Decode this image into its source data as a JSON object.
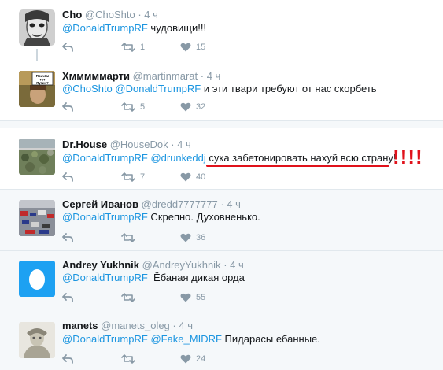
{
  "tweets": [
    {
      "name": "Cho",
      "handle": "@ChoShto",
      "time": "· 4 ч",
      "mentions": [
        "@DonaldTrumpRF"
      ],
      "text": " чудовищи!!!",
      "retweets": "1",
      "likes": "15"
    },
    {
      "name": "Хмммммарти",
      "handle": "@martinmarat",
      "time": "· 4 ч",
      "mentions": [
        "@ChoShto",
        "@DonaldTrumpRF"
      ],
      "text": " и эти твари требуют от нас скорбеть",
      "avatar_caption": "Причём тут Путин?",
      "retweets": "5",
      "likes": "32"
    },
    {
      "name": "Dr.House",
      "handle": "@HouseDok",
      "time": "· 4 ч",
      "mentions": [
        "@DonaldTrumpRF",
        "@drunkeddj"
      ],
      "text": " сука забетонировать нахуй всю страну!",
      "annotation": "!!!!",
      "retweets": "7",
      "likes": "40"
    },
    {
      "name": "Сергей Иванов",
      "handle": "@dredd7777777",
      "time": "· 4 ч",
      "mentions": [
        "@DonaldTrumpRF"
      ],
      "text": " Скрепно. Духовненько.",
      "retweets": "",
      "likes": "36"
    },
    {
      "name": "Andrey Yukhnik",
      "handle": "@AndreyYukhnik",
      "time": "· 4 ч",
      "mentions": [
        "@DonaldTrumpRF"
      ],
      "text": "  Ёбаная дикая орда",
      "retweets": "",
      "likes": "55"
    },
    {
      "name": "manets",
      "handle": "@manets_oleg",
      "time": "· 4 ч",
      "mentions": [
        "@DonaldTrumpRF",
        "@Fake_MIDRF"
      ],
      "text": " Пидарасы ебанные.",
      "retweets": "",
      "likes": "24"
    }
  ],
  "colors": {
    "mention": "#1b95e0",
    "muted": "#8899a6",
    "annotation": "#e0121b",
    "alt_bg": "#f5f8fa"
  },
  "icons": [
    "reply-icon",
    "retweet-icon",
    "like-icon"
  ]
}
